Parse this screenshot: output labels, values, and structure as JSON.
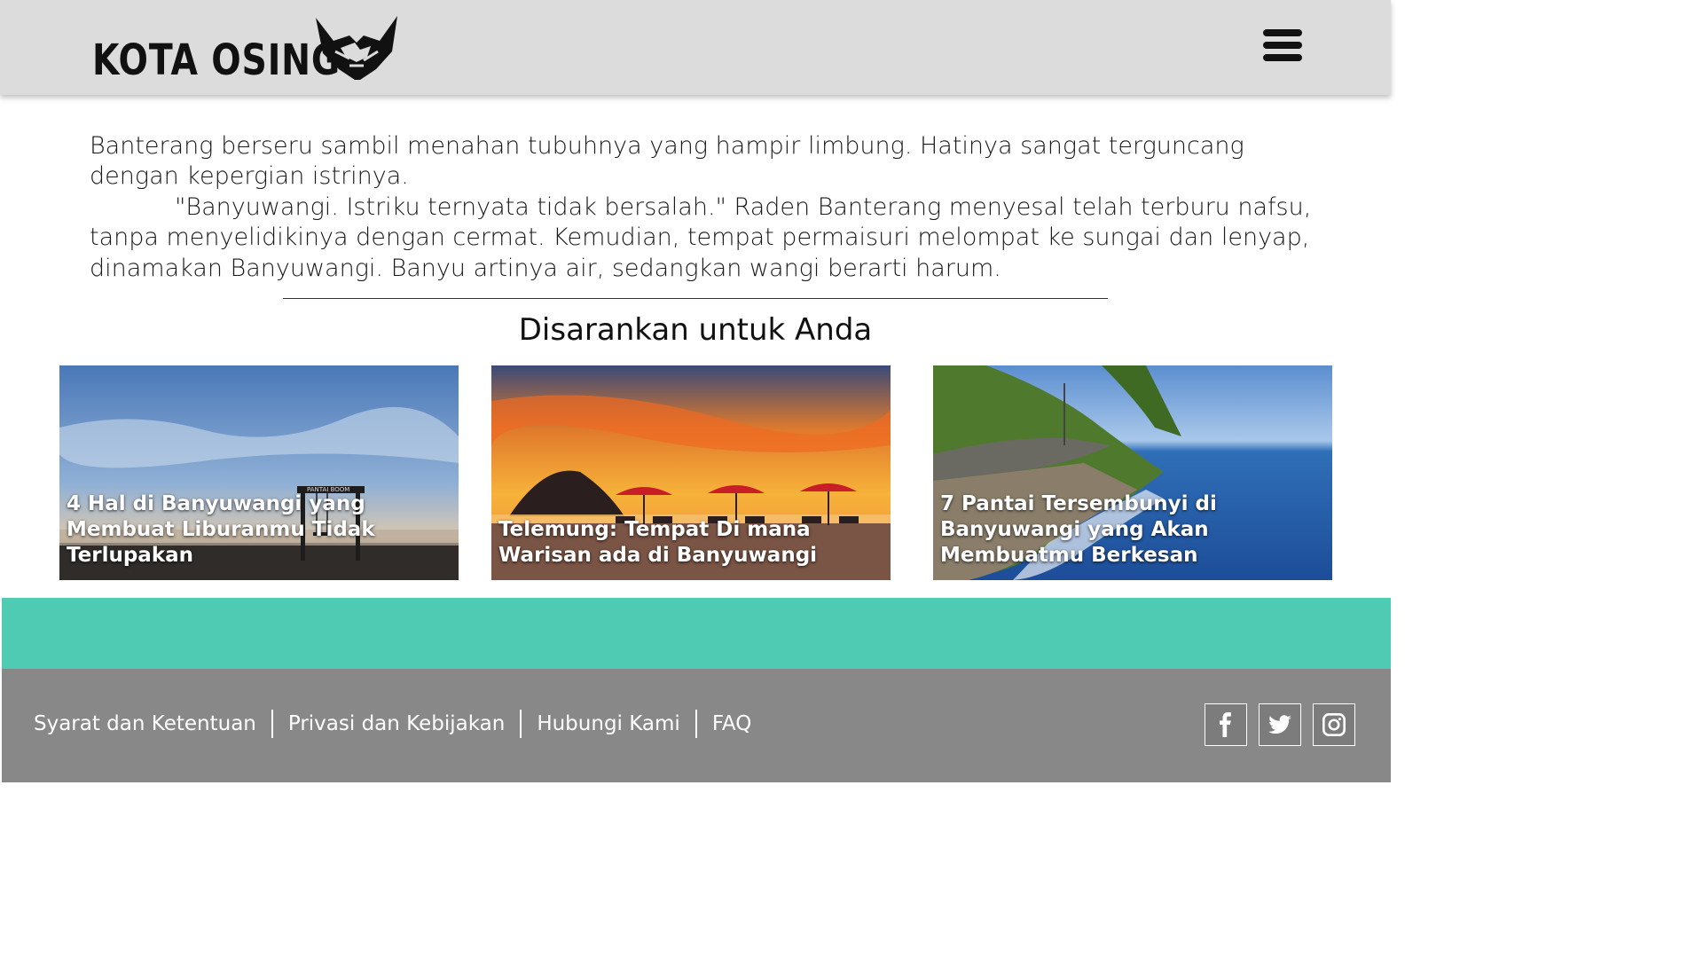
{
  "header": {
    "logo_text": "KOTA OSING",
    "menu_icon": "hamburger-menu-icon"
  },
  "article": {
    "paragraph_1": "Banterang berseru sambil menahan tubuhnya yang hampir limbung. Hatinya sangat terguncang dengan kepergian istrinya.",
    "paragraph_2": "\"Banyuwangi. Istriku ternyata tidak bersalah.\" Raden Banterang menyesal telah terburu nafsu, tanpa menyelidikinya dengan cermat. Kemudian, tempat permaisuri melompat ke sungai dan lenyap, dinamakan Banyuwangi. Banyu artinya air, sedangkan wangi berarti harum."
  },
  "suggestions": {
    "title": "Disarankan untuk Anda",
    "cards": [
      {
        "title": "4 Hal di Banyuwangi yang Membuat Liburanmu Tidak Terlupakan",
        "image_sign": "PANTAI BOOM"
      },
      {
        "title": "Telemung: Tempat Di mana Warisan ada di Banyuwangi"
      },
      {
        "title": "7 Pantai Tersembunyi di Banyuwangi yang Akan Membuatmu Berkesan"
      }
    ]
  },
  "footer": {
    "links": [
      "Syarat dan Ketentuan",
      "Privasi dan Kebijakan",
      "Hubungi Kami",
      "FAQ"
    ],
    "social": [
      "facebook-icon",
      "twitter-icon",
      "instagram-icon"
    ]
  },
  "colors": {
    "header_bg": "#dcdcdc",
    "band": "#50cbb3",
    "footer_bg": "#888888"
  }
}
